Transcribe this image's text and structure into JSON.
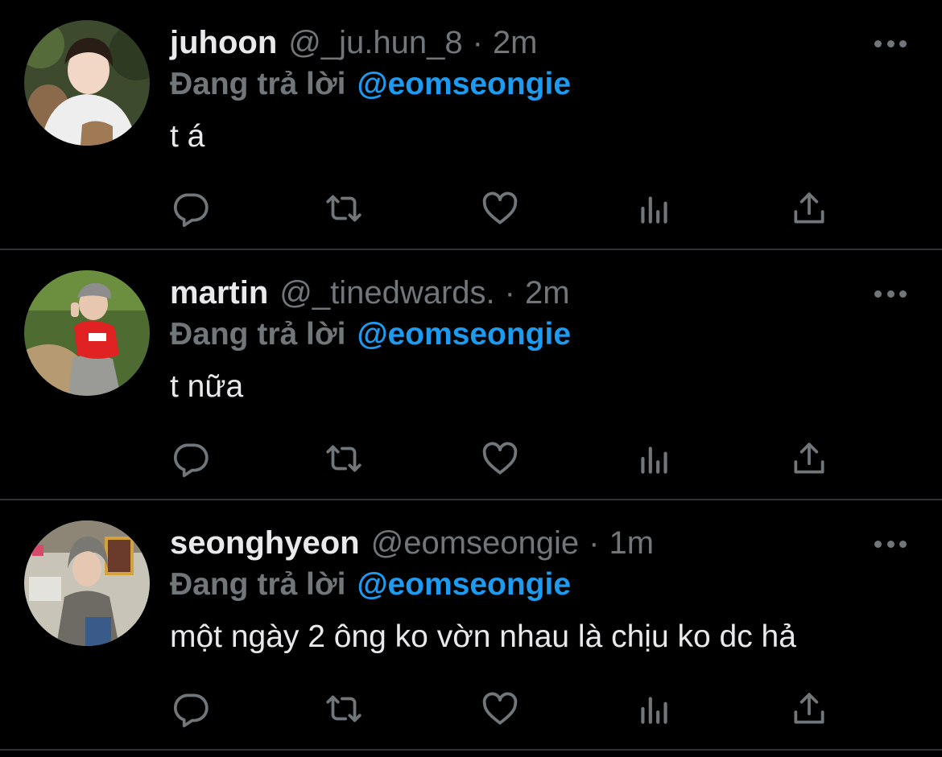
{
  "tweets": [
    {
      "display_name": "juhoon",
      "handle": "@_ju.hun_8",
      "separator": "·",
      "time": "2m",
      "reply_prefix": "Đang trả lời",
      "reply_mention": "@eomseongie",
      "text": "t á",
      "avatar_icon": "avatar-photo"
    },
    {
      "display_name": "martin",
      "handle": "@_tinedwards.",
      "separator": "·",
      "time": "2m",
      "reply_prefix": "Đang trả lời",
      "reply_mention": "@eomseongie",
      "text": "t nữa",
      "avatar_icon": "avatar-photo"
    },
    {
      "display_name": "seonghyeon",
      "handle": "@eomseongie",
      "separator": "·",
      "time": "1m",
      "reply_prefix": "Đang trả lời",
      "reply_mention": "@eomseongie",
      "text": "một ngày 2 ông ko vờn nhau là chịu ko dc hả",
      "avatar_icon": "avatar-photo"
    }
  ],
  "action_icons": [
    "reply-icon",
    "retweet-icon",
    "like-icon",
    "views-icon",
    "share-icon"
  ],
  "colors": {
    "background": "#000000",
    "primary_text": "#e7e9ea",
    "secondary_text": "#71767b",
    "mention": "#1d9bf0",
    "divider": "#2f3336"
  }
}
